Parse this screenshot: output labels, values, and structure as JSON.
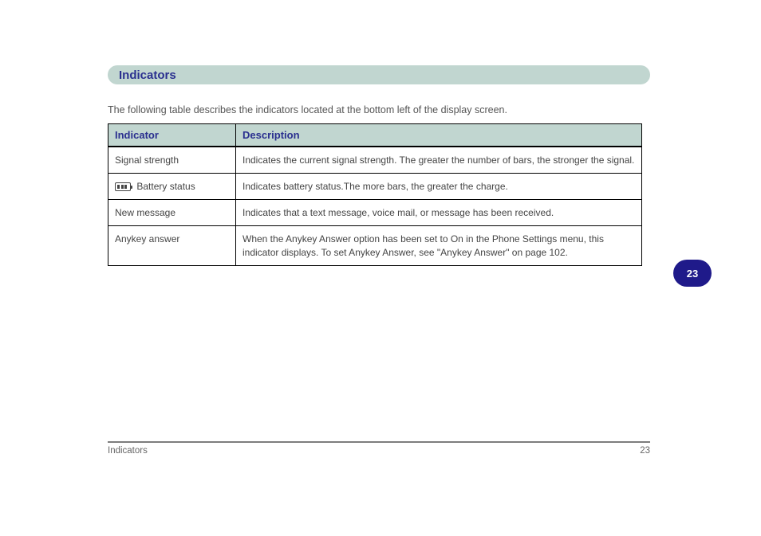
{
  "section": {
    "title": "Indicators"
  },
  "intro": "The following table describes the indicators located at the bottom left of the display screen.",
  "table": {
    "headers": [
      "Indicator",
      "Description"
    ],
    "rows": [
      {
        "left": "Signal strength",
        "right": "Indicates the current signal strength. The greater the number of bars, the stronger the signal."
      },
      {
        "left_icon": "battery",
        "left": "Battery status",
        "right": "Indicates battery status.The more bars, the greater the charge."
      },
      {
        "left": "New message",
        "right": "Indicates that a text message, voice mail, or message has been received."
      },
      {
        "left": "Anykey answer",
        "right": "When the Anykey Answer option has been set to On in the Phone Settings menu, this indicator displays. To set Anykey Answer, see \"Anykey Answer\" on page 102."
      }
    ]
  },
  "page_tab": "23",
  "footer": {
    "left": "Indicators",
    "right": "23"
  }
}
